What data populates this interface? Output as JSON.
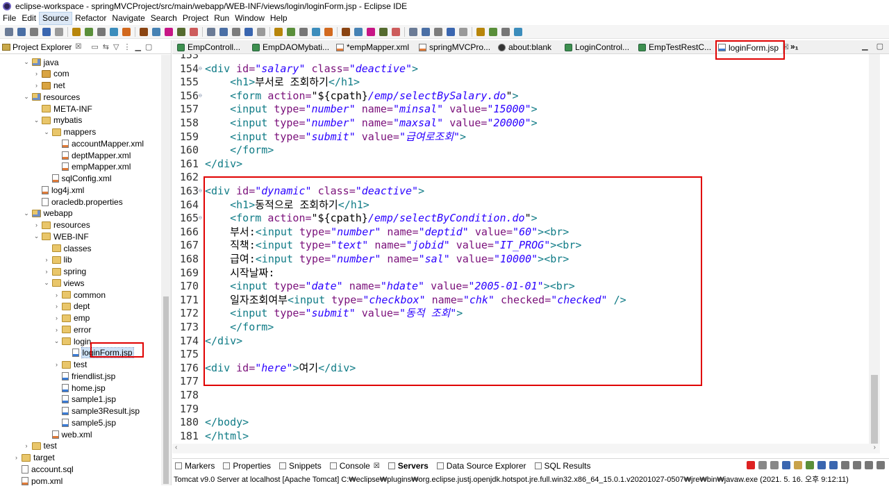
{
  "window": {
    "title": "eclipse-workspace - springMVCProject/src/main/webapp/WEB-INF/views/login/loginForm.jsp - Eclipse IDE"
  },
  "menu": [
    "File",
    "Edit",
    "Source",
    "Refactor",
    "Navigate",
    "Search",
    "Project",
    "Run",
    "Window",
    "Help"
  ],
  "menu_active": "Source",
  "explorer": {
    "title": "Project Explorer",
    "close": "☒",
    "tree": [
      {
        "label": "java",
        "level": 1,
        "icon": "srcfolder",
        "toggle": "v"
      },
      {
        "label": "com",
        "level": 2,
        "icon": "pkg",
        "toggle": ">"
      },
      {
        "label": "net",
        "level": 2,
        "icon": "pkg",
        "toggle": ">"
      },
      {
        "label": "resources",
        "level": 1,
        "icon": "srcfolder",
        "toggle": "v"
      },
      {
        "label": "META-INF",
        "level": 2,
        "icon": "folder",
        "toggle": ""
      },
      {
        "label": "mybatis",
        "level": 2,
        "icon": "folder",
        "toggle": "v"
      },
      {
        "label": "mappers",
        "level": 3,
        "icon": "folder",
        "toggle": "v"
      },
      {
        "label": "accountMapper.xml",
        "level": 4,
        "icon": "xml",
        "toggle": ""
      },
      {
        "label": "deptMapper.xml",
        "level": 4,
        "icon": "xml",
        "toggle": ""
      },
      {
        "label": "empMapper.xml",
        "level": 4,
        "icon": "xml",
        "toggle": ""
      },
      {
        "label": "sqlConfig.xml",
        "level": 3,
        "icon": "xml",
        "toggle": ""
      },
      {
        "label": "log4j.xml",
        "level": 2,
        "icon": "xml",
        "toggle": ""
      },
      {
        "label": "oracledb.properties",
        "level": 2,
        "icon": "file",
        "toggle": ""
      },
      {
        "label": "webapp",
        "level": 1,
        "icon": "srcfolder",
        "toggle": "v"
      },
      {
        "label": "resources",
        "level": 2,
        "icon": "folder",
        "toggle": ">"
      },
      {
        "label": "WEB-INF",
        "level": 2,
        "icon": "folder",
        "toggle": "v"
      },
      {
        "label": "classes",
        "level": 3,
        "icon": "folder",
        "toggle": ""
      },
      {
        "label": "lib",
        "level": 3,
        "icon": "folder",
        "toggle": ">"
      },
      {
        "label": "spring",
        "level": 3,
        "icon": "folder",
        "toggle": ">"
      },
      {
        "label": "views",
        "level": 3,
        "icon": "folder",
        "toggle": "v"
      },
      {
        "label": "common",
        "level": 4,
        "icon": "folder",
        "toggle": ">"
      },
      {
        "label": "dept",
        "level": 4,
        "icon": "folder",
        "toggle": ">"
      },
      {
        "label": "emp",
        "level": 4,
        "icon": "folder",
        "toggle": ">"
      },
      {
        "label": "error",
        "level": 4,
        "icon": "folder",
        "toggle": ">"
      },
      {
        "label": "login",
        "level": 4,
        "icon": "folder",
        "toggle": "v"
      },
      {
        "label": "loginForm.jsp",
        "level": 5,
        "icon": "jsp",
        "toggle": "",
        "selected": true
      },
      {
        "label": "test",
        "level": 4,
        "icon": "folder",
        "toggle": ">"
      },
      {
        "label": "friendlist.jsp",
        "level": 4,
        "icon": "jsp",
        "toggle": ""
      },
      {
        "label": "home.jsp",
        "level": 4,
        "icon": "jsp",
        "toggle": ""
      },
      {
        "label": "sample1.jsp",
        "level": 4,
        "icon": "jsp",
        "toggle": ""
      },
      {
        "label": "sample3Result.jsp",
        "level": 4,
        "icon": "jsp",
        "toggle": ""
      },
      {
        "label": "sample5.jsp",
        "level": 4,
        "icon": "jsp",
        "toggle": ""
      },
      {
        "label": "web.xml",
        "level": 3,
        "icon": "xml",
        "toggle": ""
      },
      {
        "label": "test",
        "level": 1,
        "icon": "folder",
        "toggle": ">"
      },
      {
        "label": "target",
        "level": 0,
        "icon": "folder",
        "toggle": ">"
      },
      {
        "label": "account.sql",
        "level": 0,
        "icon": "file",
        "toggle": ""
      },
      {
        "label": "pom.xml",
        "level": 0,
        "icon": "xml",
        "toggle": ""
      }
    ]
  },
  "editor": {
    "tabs": [
      {
        "label": "EmpControll...",
        "kind": "java"
      },
      {
        "label": "EmpDAOMybati...",
        "kind": "java"
      },
      {
        "label": "*empMapper.xml",
        "kind": "xml"
      },
      {
        "label": "springMVCPro...",
        "kind": "xml"
      },
      {
        "label": "about:blank",
        "kind": "web"
      },
      {
        "label": "LoginControl...",
        "kind": "java"
      },
      {
        "label": "EmpTestRestC...",
        "kind": "java"
      },
      {
        "label": "loginForm.jsp",
        "kind": "jsp",
        "active": true
      }
    ],
    "tab_overflow": "»₁",
    "lines": [
      {
        "n": "153",
        "fold": false,
        "tokens": []
      },
      {
        "n": "154",
        "fold": true,
        "tokens": [
          [
            "tag",
            "<div "
          ],
          [
            "attr",
            "id="
          ],
          [
            "val",
            "\"salary\""
          ],
          [
            "txt",
            " "
          ],
          [
            "attr",
            "class="
          ],
          [
            "val",
            "\"deactive\""
          ],
          [
            "tag",
            ">"
          ]
        ]
      },
      {
        "n": "155",
        "fold": false,
        "tokens": [
          [
            "txt",
            "    "
          ],
          [
            "tag",
            "<h1>"
          ],
          [
            "txt",
            "부서로 조회하기"
          ],
          [
            "tag",
            "</h1>"
          ]
        ]
      },
      {
        "n": "156",
        "fold": true,
        "tokens": [
          [
            "txt",
            "    "
          ],
          [
            "tag",
            "<form "
          ],
          [
            "attr",
            "action="
          ],
          [
            "txt",
            "\"${cpath}"
          ],
          [
            "val",
            "/emp/selectBySalary.do"
          ],
          [
            "txt",
            "\""
          ],
          [
            "tag",
            ">"
          ]
        ]
      },
      {
        "n": "157",
        "fold": false,
        "tokens": [
          [
            "txt",
            "    "
          ],
          [
            "tag",
            "<input "
          ],
          [
            "attr",
            "type="
          ],
          [
            "val",
            "\"number\""
          ],
          [
            "txt",
            " "
          ],
          [
            "attr",
            "name="
          ],
          [
            "val",
            "\"minsal\""
          ],
          [
            "txt",
            " "
          ],
          [
            "attr",
            "value="
          ],
          [
            "val",
            "\"15000\""
          ],
          [
            "tag",
            ">"
          ]
        ]
      },
      {
        "n": "158",
        "fold": false,
        "tokens": [
          [
            "txt",
            "    "
          ],
          [
            "tag",
            "<input "
          ],
          [
            "attr",
            "type="
          ],
          [
            "val",
            "\"number\""
          ],
          [
            "txt",
            " "
          ],
          [
            "attr",
            "name="
          ],
          [
            "val",
            "\"maxsal\""
          ],
          [
            "txt",
            " "
          ],
          [
            "attr",
            "value="
          ],
          [
            "val",
            "\"20000\""
          ],
          [
            "tag",
            ">"
          ]
        ]
      },
      {
        "n": "159",
        "fold": false,
        "tokens": [
          [
            "txt",
            "    "
          ],
          [
            "tag",
            "<input "
          ],
          [
            "attr",
            "type="
          ],
          [
            "val",
            "\"submit\""
          ],
          [
            "txt",
            " "
          ],
          [
            "attr",
            "value="
          ],
          [
            "val",
            "\"급여로조회\""
          ],
          [
            "tag",
            ">"
          ]
        ]
      },
      {
        "n": "160",
        "fold": false,
        "tokens": [
          [
            "txt",
            "    "
          ],
          [
            "tag",
            "</form>"
          ]
        ]
      },
      {
        "n": "161",
        "fold": false,
        "tokens": [
          [
            "tag",
            "</div>"
          ]
        ]
      },
      {
        "n": "162",
        "fold": false,
        "tokens": []
      },
      {
        "n": "163",
        "fold": true,
        "tokens": [
          [
            "tag",
            "<div "
          ],
          [
            "attr",
            "id="
          ],
          [
            "val",
            "\"dynamic\""
          ],
          [
            "txt",
            " "
          ],
          [
            "attr",
            "class="
          ],
          [
            "val",
            "\"deactive\""
          ],
          [
            "tag",
            ">"
          ]
        ]
      },
      {
        "n": "164",
        "fold": false,
        "tokens": [
          [
            "txt",
            "    "
          ],
          [
            "tag",
            "<h1>"
          ],
          [
            "txt",
            "동적으로 조회하기"
          ],
          [
            "tag",
            "</h1>"
          ]
        ]
      },
      {
        "n": "165",
        "fold": true,
        "tokens": [
          [
            "txt",
            "    "
          ],
          [
            "tag",
            "<form "
          ],
          [
            "attr",
            "action="
          ],
          [
            "txt",
            "\"${cpath}"
          ],
          [
            "val",
            "/emp/selectByCondition.do"
          ],
          [
            "txt",
            "\""
          ],
          [
            "tag",
            ">"
          ]
        ]
      },
      {
        "n": "166",
        "fold": false,
        "tokens": [
          [
            "txt",
            "    부서:"
          ],
          [
            "tag",
            "<input "
          ],
          [
            "attr",
            "type="
          ],
          [
            "val",
            "\"number\""
          ],
          [
            "txt",
            " "
          ],
          [
            "attr",
            "name="
          ],
          [
            "val",
            "\"deptid\""
          ],
          [
            "txt",
            " "
          ],
          [
            "attr",
            "value="
          ],
          [
            "val",
            "\"60\""
          ],
          [
            "tag",
            "><br>"
          ]
        ]
      },
      {
        "n": "167",
        "fold": false,
        "tokens": [
          [
            "txt",
            "    직책:"
          ],
          [
            "tag",
            "<input "
          ],
          [
            "attr",
            "type="
          ],
          [
            "val",
            "\"text\""
          ],
          [
            "txt",
            " "
          ],
          [
            "attr",
            "name="
          ],
          [
            "val",
            "\"jobid\""
          ],
          [
            "txt",
            " "
          ],
          [
            "attr",
            "value="
          ],
          [
            "val",
            "\"IT_PROG\""
          ],
          [
            "tag",
            "><br>"
          ]
        ]
      },
      {
        "n": "168",
        "fold": false,
        "tokens": [
          [
            "txt",
            "    급여:"
          ],
          [
            "tag",
            "<input "
          ],
          [
            "attr",
            "type="
          ],
          [
            "val",
            "\"number\""
          ],
          [
            "txt",
            " "
          ],
          [
            "attr",
            "name="
          ],
          [
            "val",
            "\"sal\""
          ],
          [
            "txt",
            " "
          ],
          [
            "attr",
            "value="
          ],
          [
            "val",
            "\"10000\""
          ],
          [
            "tag",
            "><br>"
          ]
        ]
      },
      {
        "n": "169",
        "fold": false,
        "tokens": [
          [
            "txt",
            "    시작날짜:"
          ]
        ]
      },
      {
        "n": "170",
        "fold": false,
        "tokens": [
          [
            "txt",
            "    "
          ],
          [
            "tag",
            "<input "
          ],
          [
            "attr",
            "type="
          ],
          [
            "val",
            "\"date\""
          ],
          [
            "txt",
            " "
          ],
          [
            "attr",
            "name="
          ],
          [
            "val",
            "\"hdate\""
          ],
          [
            "txt",
            " "
          ],
          [
            "attr",
            "value="
          ],
          [
            "val",
            "\"2005-01-01\""
          ],
          [
            "tag",
            "><br>"
          ]
        ]
      },
      {
        "n": "171",
        "fold": false,
        "tokens": [
          [
            "txt",
            "    일자조회여부"
          ],
          [
            "tag",
            "<input "
          ],
          [
            "attr",
            "type="
          ],
          [
            "val",
            "\"checkbox\""
          ],
          [
            "txt",
            " "
          ],
          [
            "attr",
            "name="
          ],
          [
            "val",
            "\"chk\""
          ],
          [
            "txt",
            " "
          ],
          [
            "attr",
            "checked="
          ],
          [
            "val",
            "\"checked\""
          ],
          [
            "txt",
            " "
          ],
          [
            "tag",
            "/>"
          ]
        ]
      },
      {
        "n": "172",
        "fold": false,
        "tokens": [
          [
            "txt",
            "    "
          ],
          [
            "tag",
            "<input "
          ],
          [
            "attr",
            "type="
          ],
          [
            "val",
            "\"submit\""
          ],
          [
            "txt",
            " "
          ],
          [
            "attr",
            "value="
          ],
          [
            "val",
            "\"동적 조회\""
          ],
          [
            "tag",
            ">"
          ]
        ]
      },
      {
        "n": "173",
        "fold": false,
        "tokens": [
          [
            "txt",
            "    "
          ],
          [
            "tag",
            "</form>"
          ]
        ]
      },
      {
        "n": "174",
        "fold": false,
        "tokens": [
          [
            "tag",
            "</div>"
          ]
        ]
      },
      {
        "n": "175",
        "fold": false,
        "tokens": []
      },
      {
        "n": "176",
        "fold": false,
        "tokens": [
          [
            "tag",
            "<div "
          ],
          [
            "attr",
            "id="
          ],
          [
            "val",
            "\"here\""
          ],
          [
            "tag",
            ">"
          ],
          [
            "txt",
            "여기"
          ],
          [
            "tag",
            "</div>"
          ]
        ]
      },
      {
        "n": "177",
        "fold": false,
        "tokens": []
      },
      {
        "n": "178",
        "fold": false,
        "tokens": []
      },
      {
        "n": "179",
        "fold": false,
        "tokens": []
      },
      {
        "n": "180",
        "fold": false,
        "tokens": [
          [
            "tag",
            "</body>"
          ]
        ]
      },
      {
        "n": "181",
        "fold": false,
        "tokens": [
          [
            "tag",
            "</html>"
          ]
        ]
      }
    ]
  },
  "bottom": {
    "tabs": [
      {
        "label": "Markers"
      },
      {
        "label": "Properties"
      },
      {
        "label": "Snippets"
      },
      {
        "label": "Console",
        "close": "☒"
      },
      {
        "label": "Servers",
        "active": true
      },
      {
        "label": "Data Source Explorer"
      },
      {
        "label": "SQL Results"
      }
    ],
    "console_status": "Tomcat v9.0 Server at localhost [Apache Tomcat] C:₩eclipse₩plugins₩org.eclipse.justj.openjdk.hotspot.jre.full.win32.x86_64_15.0.1.v20201027-0507₩jre₩bin₩javaw.exe  (2021. 5. 16. 오후 9:12:11)"
  },
  "colors": {
    "tag": "#0f7b86",
    "attribute": "#7a0f7a",
    "value": "#2a00ff",
    "highlight_box": "#e00000",
    "selection": "#cde2f7"
  }
}
